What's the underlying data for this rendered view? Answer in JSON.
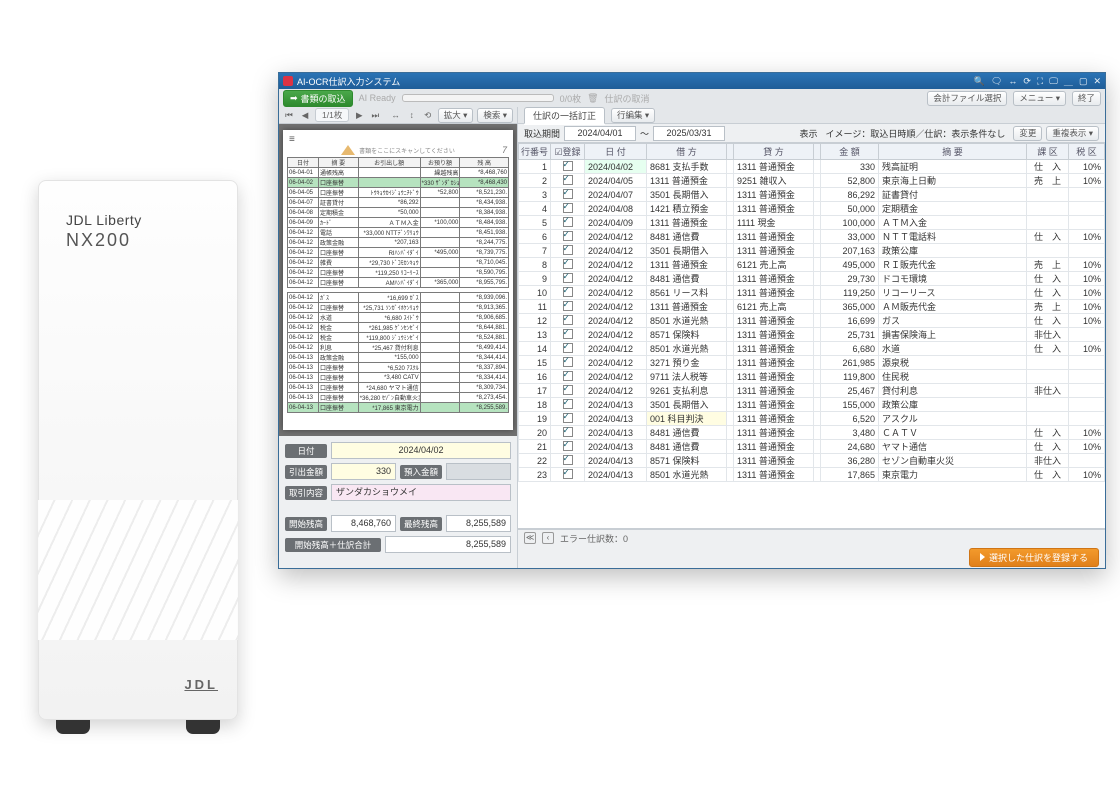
{
  "hardware": {
    "brand": "JDL Liberty",
    "model": "NX200",
    "logo": "JDL"
  },
  "window": {
    "title": "AI-OCR仕訳入力システム"
  },
  "titlebar_icons": [
    "🔍",
    "🗨",
    "↔",
    "⟳",
    "⛶",
    "🖵",
    "＿",
    "▢",
    "✕"
  ],
  "menubar": {
    "import": "書類の取込",
    "ai": "AI Ready",
    "progress": "0/0枚",
    "delete_entry": "仕訳の取消",
    "file_select": "会計ファイル選択",
    "menu": "メニュー ▾",
    "exit": "終了"
  },
  "left_toolbar": {
    "page": "1/1枚",
    "rotate": "⟲",
    "zoomV": "⤢",
    "zoom": "拡大 ▾",
    "search": "検索 ▾"
  },
  "sheet": {
    "hint": "書類をここにスキャンしてください",
    "pgno": "7",
    "headers": [
      "日付",
      "摘    要",
      "お引出し額",
      "お預り額",
      "残    高"
    ],
    "rows": [
      {
        "d": "06-04-01",
        "m": "通帳残高",
        "w": "",
        "p": "繰越残高",
        "b": "*8,468,760"
      },
      {
        "d": "06-04-02",
        "m": "口座振替",
        "w": "",
        "p": "*330 ｻﾞﾝﾀﾞｶｼｮｳﾒｲ",
        "b": "*8,468,430",
        "hl": true
      },
      {
        "d": "06-04-05",
        "m": "口座振替",
        "w": "ﾄｳｷｮｳｶｲｼﾞｮｳﾆﾁﾄﾞｳ",
        "p": "*52,800",
        "b": "*8,521,230."
      },
      {
        "d": "06-04-07",
        "m": "証書貸付",
        "w": "*86,292",
        "p": "",
        "b": "*8,434,938."
      },
      {
        "d": "06-04-08",
        "m": "定期積金",
        "w": "*50,000",
        "p": "",
        "b": "*8,384,938."
      },
      {
        "d": "06-04-09",
        "m": "ｶｰﾄﾞ",
        "w": "ＡＴＭ入金",
        "p": "*100,000",
        "b": "*8,484,938."
      },
      {
        "d": "06-04-12",
        "m": "電話",
        "w": "*33,000 NTTﾃﾞﾝﾜﾘｮｳ",
        "p": "",
        "b": "*8,451,938."
      },
      {
        "d": "06-04-12",
        "m": "政策金融",
        "w": "*207,163",
        "p": "",
        "b": "*8,244,775."
      },
      {
        "d": "06-04-12",
        "m": "口座振替",
        "w": "RIﾊﾝﾊﾞｲﾀﾞｲ",
        "p": "*495,000",
        "b": "*8,739,775."
      },
      {
        "d": "06-04-12",
        "m": "雑費",
        "w": "*29,730 ﾄﾞｺﾓｶﾝｷｮｳ",
        "p": "",
        "b": "*8,710,045."
      },
      {
        "d": "06-04-12",
        "m": "口座振替",
        "w": "*119,250 ﾘｺｰﾘｰｽ",
        "p": "",
        "b": "*8,590,795."
      },
      {
        "d": "06-04-12",
        "m": "口座振替",
        "w": "AMﾊﾝﾊﾞｲﾀﾞｲ",
        "p": "*365,000",
        "b": "*8,955,795."
      }
    ],
    "rows2": [
      {
        "d": "06-04-12",
        "m": "ｶﾞｽ",
        "w": "*16,699 ｶﾞｽ",
        "p": "",
        "b": "*8,939,096."
      },
      {
        "d": "06-04-12",
        "m": "口座振替",
        "w": "*25,731 ｿﾝｶﾞｲﾎｹﾝﾘｮｳ",
        "p": "",
        "b": "*8,913,365."
      },
      {
        "d": "06-04-12",
        "m": "水道",
        "w": "*6,680 ｽｲﾄﾞｳ",
        "p": "",
        "b": "*8,906,685."
      },
      {
        "d": "06-04-12",
        "m": "税金",
        "w": "*261,985 ｹﾞﾝｾﾝｾﾞｲ",
        "p": "",
        "b": "*8,644,881."
      },
      {
        "d": "06-04-12",
        "m": "税金",
        "w": "*119,800 ｼﾞｭｳﾐﾝｾﾞｲ",
        "p": "",
        "b": "*8,524,881."
      },
      {
        "d": "06-04-12",
        "m": "利息",
        "w": "*25,467 貸付利息",
        "p": "",
        "b": "*8,499,414."
      },
      {
        "d": "06-04-13",
        "m": "政策金融",
        "w": "*155,000",
        "p": "",
        "b": "*8,344,414."
      },
      {
        "d": "06-04-13",
        "m": "口座振替",
        "w": "*6,520 ｱｽｸﾙ",
        "p": "",
        "b": "*8,337,894."
      },
      {
        "d": "06-04-13",
        "m": "口座振替",
        "w": "*3,480 CATV",
        "p": "",
        "b": "*8,334,414."
      },
      {
        "d": "06-04-13",
        "m": "口座振替",
        "w": "*24,680 ヤマト通信",
        "p": "",
        "b": "*8,309,734."
      },
      {
        "d": "06-04-13",
        "m": "口座振替",
        "w": "*36,280 ｾｿﾞﾝ自動車火災",
        "p": "",
        "b": "*8,273,454."
      },
      {
        "d": "06-04-13",
        "m": "口座振替",
        "w": "*17,865 東京電力",
        "p": "",
        "b": "*8,255,589.",
        "hl": true
      }
    ]
  },
  "fields": {
    "date_lab": "日付",
    "date": "2024/04/02",
    "withdraw_lab": "引出金額",
    "withdraw": "330",
    "deposit_lab": "預入金額",
    "deposit": "",
    "desc_lab": "取引内容",
    "desc": "ザンダカショウメイ",
    "open_lab": "開始残高",
    "open": "8,468,760",
    "close_lab": "最終残高",
    "close": "8,255,589",
    "sum_lab": "開始残高＋仕訳合計",
    "sum": "8,255,589"
  },
  "right": {
    "tab1": "仕訳の一括訂正",
    "tab2": "行編集 ▾",
    "period_lab": "取込期間",
    "from": "2024/04/01",
    "to": "2025/03/31",
    "tilde": "～",
    "disp_lab": "表示",
    "disp_val": "イメージ：取込日時順／仕訳：表示条件なし",
    "change": "変更",
    "dup": "重複表示 ▾",
    "headers": [
      "行番号",
      "☑登録",
      "日 付",
      "借 方",
      "",
      "貸 方",
      "",
      "金 額",
      "摘 要",
      "課 区",
      "税 区"
    ]
  },
  "rows": [
    {
      "n": 1,
      "d": "2024/04/02",
      "dr": "8681 支払手数",
      "cr": "1311 普通預金",
      "a": "330",
      "m": "残高証明",
      "k": "仕　入",
      "t": "10%",
      "hl_date": true
    },
    {
      "n": 2,
      "d": "2024/04/05",
      "dr": "1311 普通預金",
      "cr": "9251 雑収入",
      "a": "52,800",
      "m": "東京海上日動",
      "k": "売　上",
      "t": "10%"
    },
    {
      "n": 3,
      "d": "2024/04/07",
      "dr": "3501 長期借入",
      "cr": "1311 普通預金",
      "a": "86,292",
      "m": "証書貸付",
      "k": "",
      "t": ""
    },
    {
      "n": 4,
      "d": "2024/04/08",
      "dr": "1421 積立預金",
      "cr": "1311 普通預金",
      "a": "50,000",
      "m": "定期積金",
      "k": "",
      "t": ""
    },
    {
      "n": 5,
      "d": "2024/04/09",
      "dr": "1311 普通預金",
      "cr": "1111 現金",
      "a": "100,000",
      "m": "ＡＴＭ入金",
      "k": "",
      "t": ""
    },
    {
      "n": 6,
      "d": "2024/04/12",
      "dr": "8481 通信費",
      "cr": "1311 普通預金",
      "a": "33,000",
      "m": "ＮＴＴ電話料",
      "k": "仕　入",
      "t": "10%"
    },
    {
      "n": 7,
      "d": "2024/04/12",
      "dr": "3501 長期借入",
      "cr": "1311 普通預金",
      "a": "207,163",
      "m": "政策公庫",
      "k": "",
      "t": ""
    },
    {
      "n": 8,
      "d": "2024/04/12",
      "dr": "1311 普通預金",
      "cr": "6121 売上高",
      "a": "495,000",
      "m": "ＲＩ販売代金",
      "k": "売　上",
      "t": "10%"
    },
    {
      "n": 9,
      "d": "2024/04/12",
      "dr": "8481 通信費",
      "cr": "1311 普通預金",
      "a": "29,730",
      "m": "ドコモ環境",
      "k": "仕　入",
      "t": "10%"
    },
    {
      "n": 10,
      "d": "2024/04/12",
      "dr": "8561 リース料",
      "cr": "1311 普通預金",
      "a": "119,250",
      "m": "リコーリース",
      "k": "仕　入",
      "t": "10%"
    },
    {
      "n": 11,
      "d": "2024/04/12",
      "dr": "1311 普通預金",
      "cr": "6121 売上高",
      "a": "365,000",
      "m": "ＡＭ販売代金",
      "k": "売　上",
      "t": "10%"
    },
    {
      "n": 12,
      "d": "2024/04/12",
      "dr": "8501 水道光熱",
      "cr": "1311 普通預金",
      "a": "16,699",
      "m": "ガス",
      "k": "仕　入",
      "t": "10%"
    },
    {
      "n": 13,
      "d": "2024/04/12",
      "dr": "8571 保険料",
      "cr": "1311 普通預金",
      "a": "25,731",
      "m": "損害保険海上",
      "k": "非仕入",
      "t": ""
    },
    {
      "n": 14,
      "d": "2024/04/12",
      "dr": "8501 水道光熱",
      "cr": "1311 普通預金",
      "a": "6,680",
      "m": "水道",
      "k": "仕　入",
      "t": "10%"
    },
    {
      "n": 15,
      "d": "2024/04/12",
      "dr": "3271 預り金",
      "cr": "1311 普通預金",
      "a": "261,985",
      "m": "源泉税",
      "k": "",
      "t": ""
    },
    {
      "n": 16,
      "d": "2024/04/12",
      "dr": "9711 法人税等",
      "cr": "1311 普通預金",
      "a": "119,800",
      "m": "住民税",
      "k": "",
      "t": ""
    },
    {
      "n": 17,
      "d": "2024/04/12",
      "dr": "9261 支払利息",
      "cr": "1311 普通預金",
      "a": "25,467",
      "m": "貸付利息",
      "k": "非仕入",
      "t": ""
    },
    {
      "n": 18,
      "d": "2024/04/13",
      "dr": "3501 長期借入",
      "cr": "1311 普通預金",
      "a": "155,000",
      "m": "政策公庫",
      "k": "",
      "t": ""
    },
    {
      "n": 19,
      "d": "2024/04/13",
      "dr": "001 科目判決",
      "cr": "1311 普通預金",
      "a": "6,520",
      "m": "アスクル",
      "k": "",
      "t": "",
      "hl_dr": true
    },
    {
      "n": 20,
      "d": "2024/04/13",
      "dr": "8481 通信費",
      "cr": "1311 普通預金",
      "a": "3,480",
      "m": "ＣＡＴＶ",
      "k": "仕　入",
      "t": "10%"
    },
    {
      "n": 21,
      "d": "2024/04/13",
      "dr": "8481 通信費",
      "cr": "1311 普通預金",
      "a": "24,680",
      "m": "ヤマト通信",
      "k": "仕　入",
      "t": "10%"
    },
    {
      "n": 22,
      "d": "2024/04/13",
      "dr": "8571 保険料",
      "cr": "1311 普通預金",
      "a": "36,280",
      "m": "セゾン自動車火災",
      "k": "非仕入",
      "t": ""
    },
    {
      "n": 23,
      "d": "2024/04/13",
      "dr": "8501 水道光熱",
      "cr": "1311 普通預金",
      "a": "17,865",
      "m": "東京電力",
      "k": "仕　入",
      "t": "10%"
    }
  ],
  "errbar": {
    "label": "エラー仕訳数：0"
  },
  "cta": "選択した仕訳を登録する"
}
